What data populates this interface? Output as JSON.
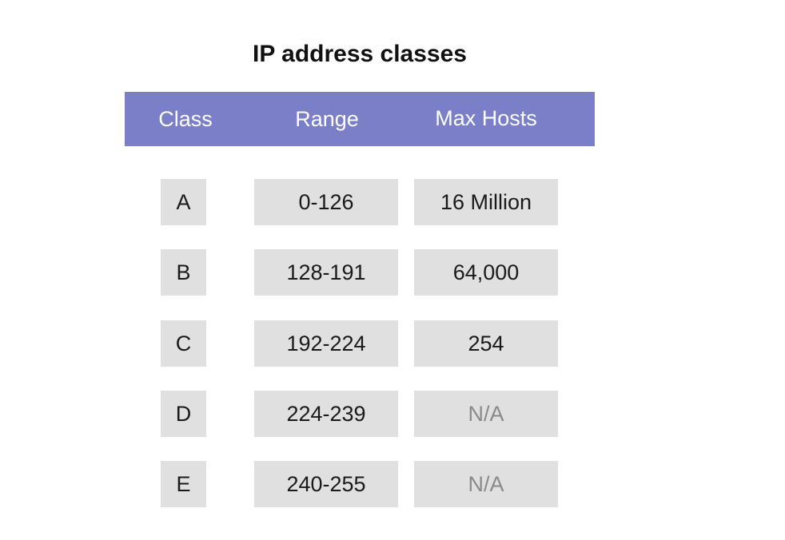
{
  "title": "IP address classes",
  "table": {
    "headers": {
      "class": "Class",
      "range": "Range",
      "max_hosts": "Max Hosts"
    },
    "rows": [
      {
        "class": "A",
        "range": "0-126",
        "max_hosts": "16 Million"
      },
      {
        "class": "B",
        "range": "128-191",
        "max_hosts": "64,000"
      },
      {
        "class": "C",
        "range": "192-224",
        "max_hosts": "254"
      },
      {
        "class": "D",
        "range": "224-239",
        "max_hosts": "N/A"
      },
      {
        "class": "E",
        "range": "240-255",
        "max_hosts": "N/A"
      }
    ]
  },
  "colors": {
    "header_background": "#7a7fc8",
    "cell_background": "#e0e0e0",
    "na_text": "#8a8a8a"
  }
}
